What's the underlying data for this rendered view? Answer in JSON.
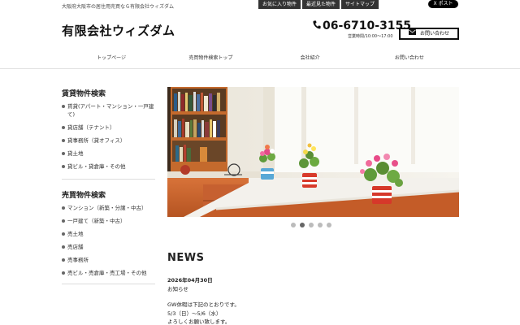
{
  "header": {
    "tagline": "大阪府大阪市の居住用売買なら有限会社ウィズダム",
    "top_links": [
      "お気に入り物件",
      "最近見た物件",
      "サイトマップ"
    ],
    "x_post": "X ポスト",
    "logo": "有限会社ウィズダム",
    "phone": "06-6710-3155",
    "hours": "営業時間/10:00〜17:00",
    "contact_button": "お問い合わせ"
  },
  "nav": [
    "トップページ",
    "売買物件検索トップ",
    "会社紹介",
    "お問い合わせ"
  ],
  "sidebar": {
    "rental_heading": "賃貸物件検索",
    "rental_items": [
      "賃貸(アパート・マンション・一戸建て)",
      "貸店舗（テナント）",
      "貸事務所（貸オフィス）",
      "貸土地",
      "貸ビル・貸倉庫・その他"
    ],
    "sale_heading": "売買物件検索",
    "sale_items": [
      "マンション（新築・分譲・中古）",
      "一戸建て（新築・中古）",
      "売土地",
      "売店舗",
      "売事務所",
      "売ビル・売倉庫・売工場・その他"
    ]
  },
  "slider": {
    "slide_count": 5,
    "active_index": 1
  },
  "news": {
    "heading": "NEWS",
    "date": "2026年04月30日",
    "title": "お知らせ",
    "body": [
      "GW休暇は下記のとおりです。",
      "5/3（日）〜5/6（水）",
      "よろしくお願い致します。"
    ]
  },
  "colors": {
    "topbar": "#333333",
    "text": "#222222"
  }
}
